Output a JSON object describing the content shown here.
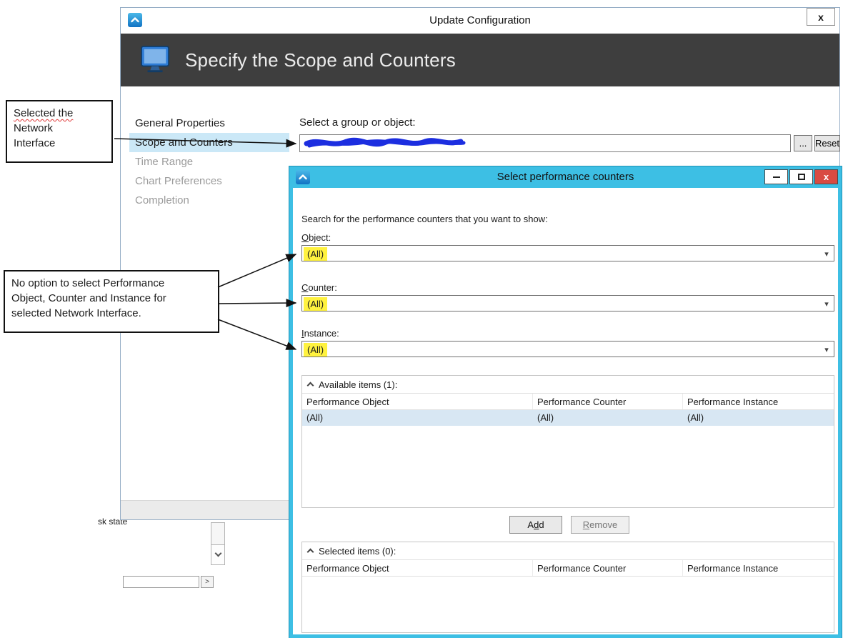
{
  "colors": {
    "accent_cyan": "#3dbfe4",
    "close_red": "#d94b42",
    "highlight_yellow": "#fff23f",
    "selected_row_blue": "#d8e7f3",
    "nav_selected_blue": "#cbe8f7",
    "header_dark": "#3e3e3e",
    "scribble_blue": "#1c2ee0"
  },
  "background_window": {
    "partial_text": "sk state",
    "scroll_right_glyph": ">"
  },
  "callouts": {
    "network_interface": {
      "line1": "Selected the",
      "line2": "Network",
      "line3": "Interface"
    },
    "no_option": {
      "line1": "No option to select Performance",
      "line2": "Object, Counter and Instance for",
      "line3": "selected Network Interface."
    }
  },
  "update_dialog": {
    "title": "Update Configuration",
    "close_label": "x",
    "header_title": "Specify the Scope and Counters",
    "nav": {
      "item1": "General Properties",
      "item2": "Scope and Counters",
      "item3": "Time Range",
      "item4": "Chart Preferences",
      "item5": "Completion"
    },
    "group_section": {
      "label": "Select a group or object:",
      "browse_label": "...",
      "reset_label": "Reset"
    }
  },
  "counters_dialog": {
    "title": "Select performance counters",
    "close_label": "x",
    "search_label": "Search for the performance counters that you want to show:",
    "dropdown_glyph": "▾",
    "object_field": {
      "pre": "",
      "key": "O",
      "post": "bject:",
      "value": "(All)"
    },
    "counter_field": {
      "pre": "",
      "key": "C",
      "post": "ounter:",
      "value": "(All)"
    },
    "instance_field": {
      "pre": "",
      "key": "I",
      "post": "nstance:",
      "value": "(All)"
    },
    "available": {
      "header": "Available items (1):",
      "col1": "Performance Object",
      "col2": "Performance Counter",
      "col3": "Performance Instance",
      "row1": {
        "c1": "(All)",
        "c2": "(All)",
        "c3": "(All)"
      }
    },
    "add_button": {
      "pre": "A",
      "key": "d",
      "post": "d"
    },
    "remove_button": {
      "pre": "",
      "key": "R",
      "post": "emove"
    },
    "selected": {
      "header": "Selected items (0):",
      "col1": "Performance Object",
      "col2": "Performance Counter",
      "col3": "Performance Instance"
    }
  }
}
